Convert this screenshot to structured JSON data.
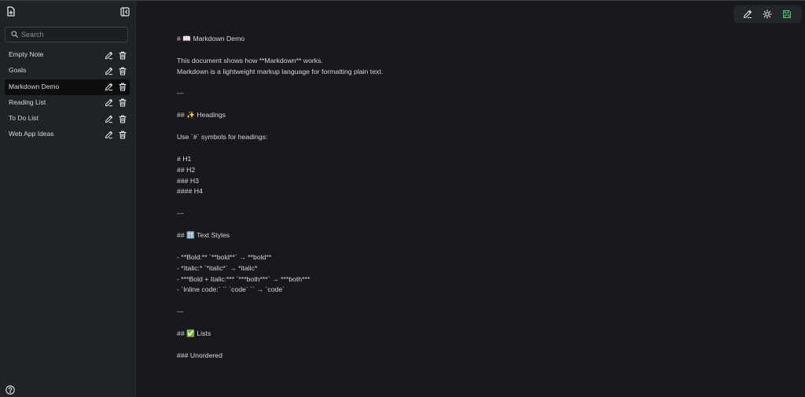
{
  "sidebar": {
    "search_placeholder": "Search",
    "notes": [
      {
        "title": "Empty Note",
        "active": false
      },
      {
        "title": "Goals",
        "active": false
      },
      {
        "title": "Markdown Demo",
        "active": true
      },
      {
        "title": "Reading List",
        "active": false
      },
      {
        "title": "To Do List",
        "active": false
      },
      {
        "title": "Web App Ideas",
        "active": false
      }
    ]
  },
  "toolbar": {
    "icons": [
      "pencil-icon",
      "sun-icon",
      "save-icon"
    ],
    "save_color": "#4ec277"
  },
  "editor": {
    "lines": [
      "# 📖 Markdown Demo",
      "",
      "This document shows how **Markdown** works.",
      "Markdown is a lightweight markup language for formatting plain text.",
      "",
      "---",
      "",
      "## ✨ Headings",
      "",
      "Use `#` symbols for headings:",
      "",
      "# H1",
      "## H2",
      "### H3",
      "#### H4",
      "",
      "---",
      "",
      "## 🔠 Text Styles",
      "",
      "- **Bold:** `**bold**` → **bold**",
      "- *Italic:* `*italic*` → *italic*",
      "- ***Bold + Italic:*** `***both***` → ***both***",
      "- `Inline code:` `` `code` `` → `code`",
      "",
      "---",
      "",
      "## ✅ Lists",
      "",
      "### Unordered"
    ]
  },
  "colors": {
    "background": "#17191d",
    "sidebar": "#1f2227",
    "active_note": "#0c0d0f",
    "text": "#d6d8db"
  }
}
